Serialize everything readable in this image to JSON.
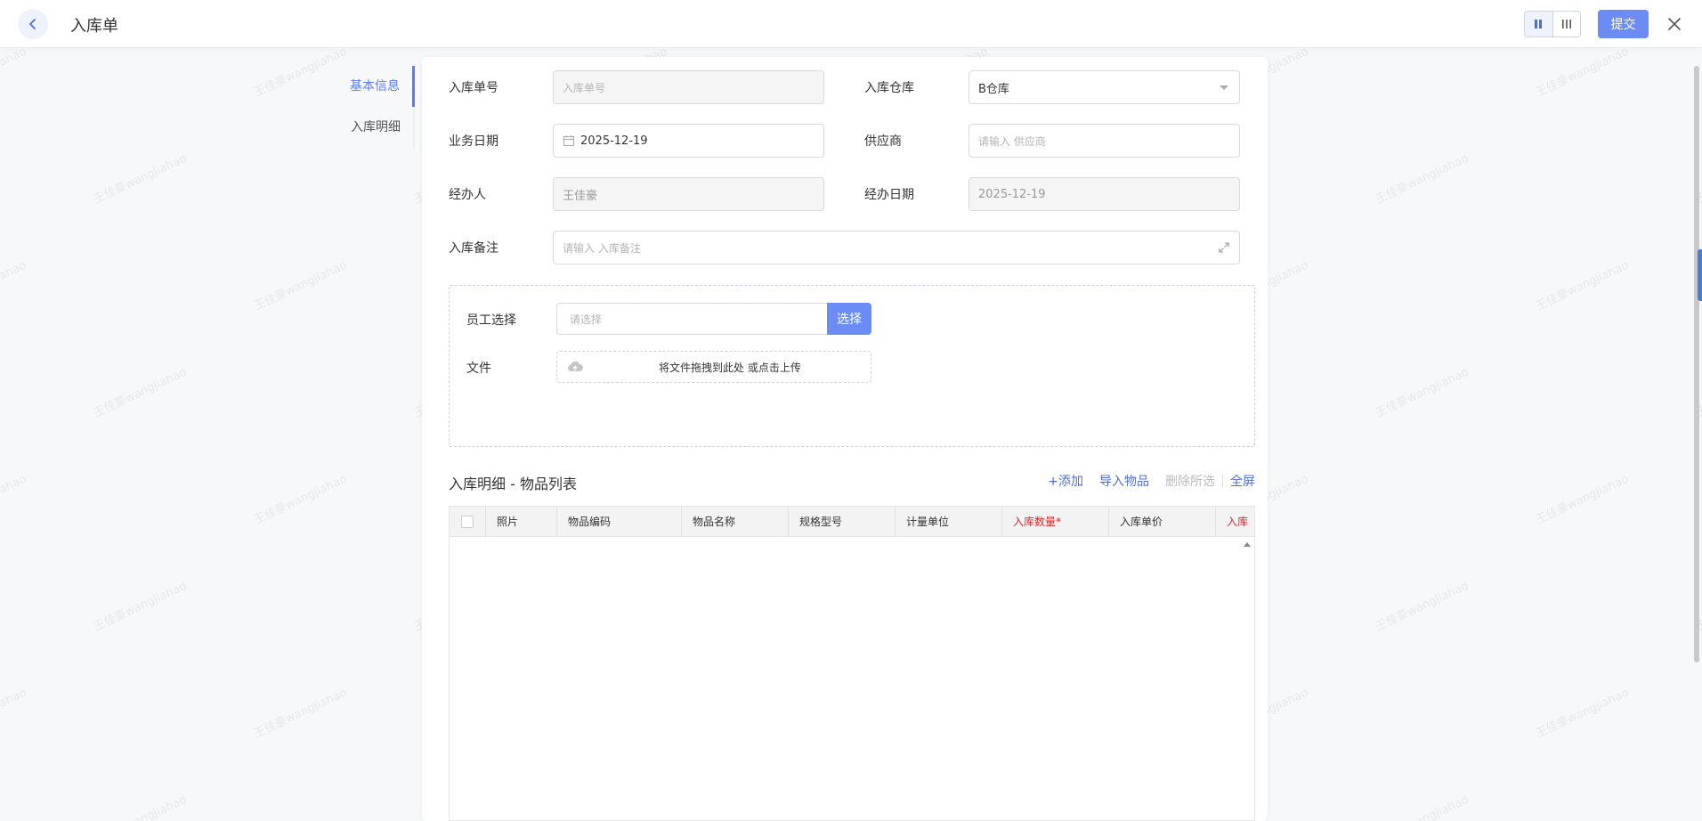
{
  "header": {
    "title": "入库单",
    "submit_label": "提交"
  },
  "anchor_nav": [
    {
      "label": "基本信息",
      "active": true
    },
    {
      "label": "入库明细",
      "active": false
    }
  ],
  "form": {
    "order_no": {
      "label": "入库单号",
      "placeholder": "入库单号"
    },
    "warehouse": {
      "label": "入库仓库",
      "value": "B仓库"
    },
    "biz_date": {
      "label": "业务日期",
      "value": "2025-12-19"
    },
    "supplier": {
      "label": "供应商",
      "placeholder": "请输入 供应商"
    },
    "handler": {
      "label": "经办人",
      "value": "王佳豪"
    },
    "handle_date": {
      "label": "经办日期",
      "value": "2025-12-19"
    },
    "remark": {
      "label": "入库备注",
      "placeholder": "请输入 入库备注"
    }
  },
  "extra": {
    "employee": {
      "label": "员工选择",
      "placeholder": "请选择",
      "button": "选择"
    },
    "file": {
      "label": "文件",
      "upload_text": "将文件拖拽到此处 或点击上传"
    }
  },
  "detail": {
    "title": "入库明细 - 物品列表",
    "toolbar": {
      "add": "+添加",
      "import": "导入物品",
      "delete": "删除所选",
      "fullscreen": "全屏"
    },
    "columns": [
      "照片",
      "物品编码",
      "物品名称",
      "规格型号",
      "计量单位",
      "入库数量*",
      "入库单价",
      "入库"
    ]
  },
  "watermark": "王佳豪wangjiahao",
  "colors": {
    "primary": "#6b8cf5",
    "link": "#4b6de0",
    "required": "#e02424"
  }
}
